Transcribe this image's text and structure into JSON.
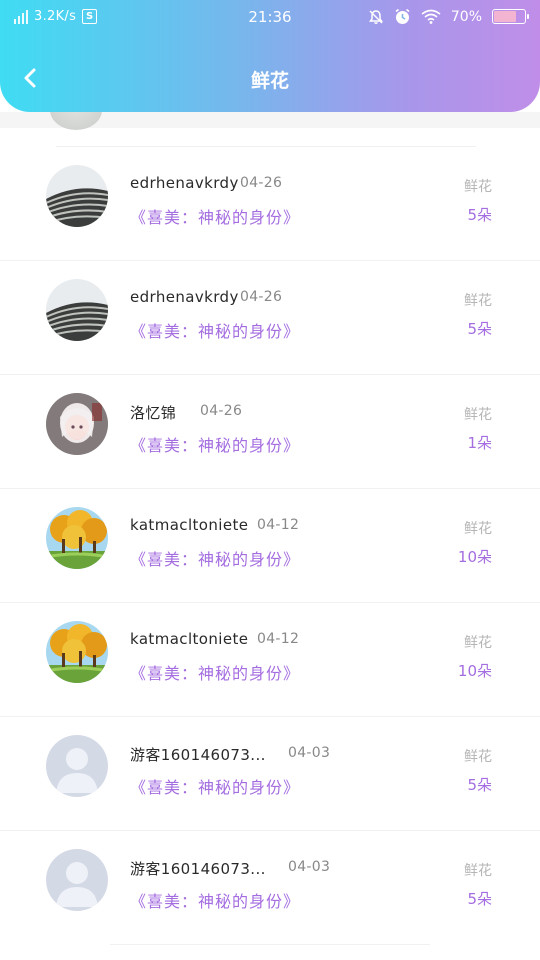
{
  "status_bar": {
    "net_speed": "3.2K/s",
    "s_badge": "S",
    "time": "21:36",
    "battery": "70%",
    "battery_level": 0.7,
    "icons": [
      "signal-icon",
      "s-app-icon",
      "mute-bell-icon",
      "alarm-icon",
      "wifi-icon",
      "battery-icon"
    ]
  },
  "header": {
    "back_icon": "chevron-left-icon",
    "title": "鲜花",
    "gradient": [
      "#3fdcf3",
      "#a797eb",
      "#c08ee8"
    ]
  },
  "colors": {
    "accent": "#a46de0",
    "muted": "#b5b5b5"
  },
  "records": [
    {
      "user": "edrhenavkrdy",
      "date": "04-26",
      "book": "《喜美：神秘的身份》",
      "gift": "鲜花",
      "count": "5朵",
      "avatar": "landscape-photo"
    },
    {
      "user": "edrhenavkrdy",
      "date": "04-26",
      "book": "《喜美：神秘的身份》",
      "gift": "鲜花",
      "count": "5朵",
      "avatar": "landscape-photo"
    },
    {
      "user": "洛忆锦",
      "date": "04-26",
      "book": "《喜美：神秘的身份》",
      "gift": "鲜花",
      "count": "1朵",
      "avatar": "anime-girl"
    },
    {
      "user": "katmacltoniete",
      "date": "04-12",
      "book": "《喜美：神秘的身份》",
      "gift": "鲜花",
      "count": "10朵",
      "avatar": "autumn-tree"
    },
    {
      "user": "katmacltoniete",
      "date": "04-12",
      "book": "《喜美：神秘的身份》",
      "gift": "鲜花",
      "count": "10朵",
      "avatar": "autumn-tree"
    },
    {
      "user": "游客160146073...",
      "date": "04-03",
      "book": "《喜美：神秘的身份》",
      "gift": "鲜花",
      "count": "5朵",
      "avatar": "default-user"
    },
    {
      "user": "游客160146073...",
      "date": "04-03",
      "book": "《喜美：神秘的身份》",
      "gift": "鲜花",
      "count": "5朵",
      "avatar": "default-user"
    }
  ]
}
